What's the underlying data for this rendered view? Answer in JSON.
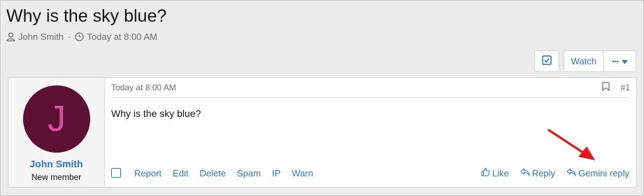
{
  "thread": {
    "title": "Why is the sky blue?",
    "author": "John Smith",
    "separator": "·",
    "date": "Today at 8:00 AM"
  },
  "toolbar": {
    "watch_label": "Watch",
    "more_label": "•••"
  },
  "post": {
    "username": "John Smith",
    "user_title": "New member",
    "avatar_letter": "J",
    "date": "Today at 8:00 AM",
    "number": "#1",
    "body": "Why is the sky blue?",
    "actions_left": [
      "Report",
      "Edit",
      "Delete",
      "Spam",
      "IP",
      "Warn"
    ],
    "actions_right": [
      "Like",
      "Reply",
      "Gemini reply"
    ]
  },
  "colors": {
    "link": "#2b77c6",
    "avatar_bg": "#5c1034",
    "avatar_fg": "#d94f9d",
    "annotation_arrow": "#e0191b"
  }
}
